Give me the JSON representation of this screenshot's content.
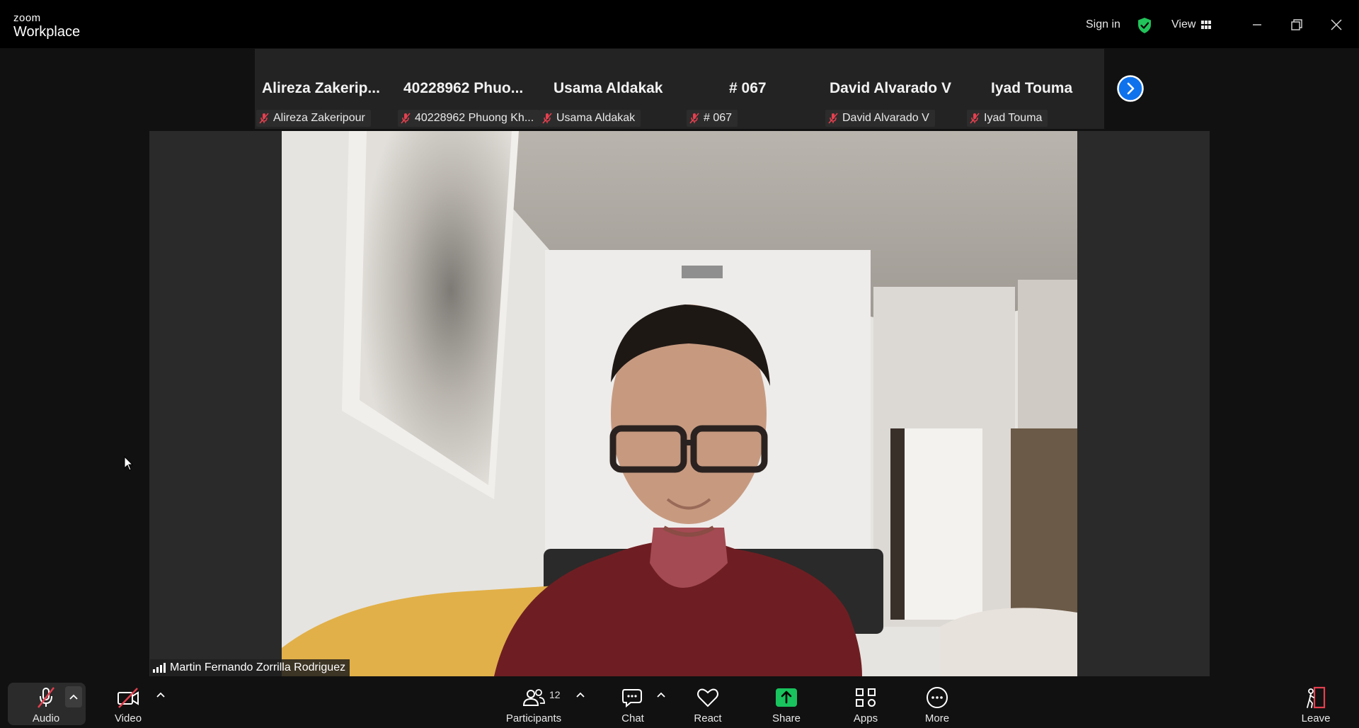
{
  "app": {
    "logo_top": "zoom",
    "logo_bottom": "Workplace"
  },
  "titlebar": {
    "sign_in": "Sign in",
    "view": "View"
  },
  "strip": {
    "tiles": [
      {
        "big": "Alireza  Zakerip...",
        "tag": "Alireza Zakeripour"
      },
      {
        "big": "40228962  Phuo...",
        "tag": "40228962 Phuong Kh..."
      },
      {
        "big": "Usama Aldakak",
        "tag": "Usama Aldakak"
      },
      {
        "big": "# 067",
        "tag": "# 067"
      },
      {
        "big": "David Alvarado V",
        "tag": "David Alvarado V"
      },
      {
        "big": "Iyad Touma",
        "tag": "Iyad Touma"
      }
    ]
  },
  "main": {
    "speaker_name": "Martin Fernando Zorrilla Rodriguez"
  },
  "toolbar": {
    "audio": "Audio",
    "video": "Video",
    "participants": "Participants",
    "participants_count": "12",
    "chat": "Chat",
    "react": "React",
    "share": "Share",
    "apps": "Apps",
    "more": "More",
    "leave": "Leave"
  },
  "colors": {
    "accent_blue": "#0e72ed",
    "share_green": "#19c35e",
    "muted_red": "#e5404f",
    "shield_green": "#21c35a"
  },
  "icons": {
    "shield": "shield-check-icon",
    "muted_mic": "mic-off-icon",
    "video_off": "video-off-icon"
  }
}
